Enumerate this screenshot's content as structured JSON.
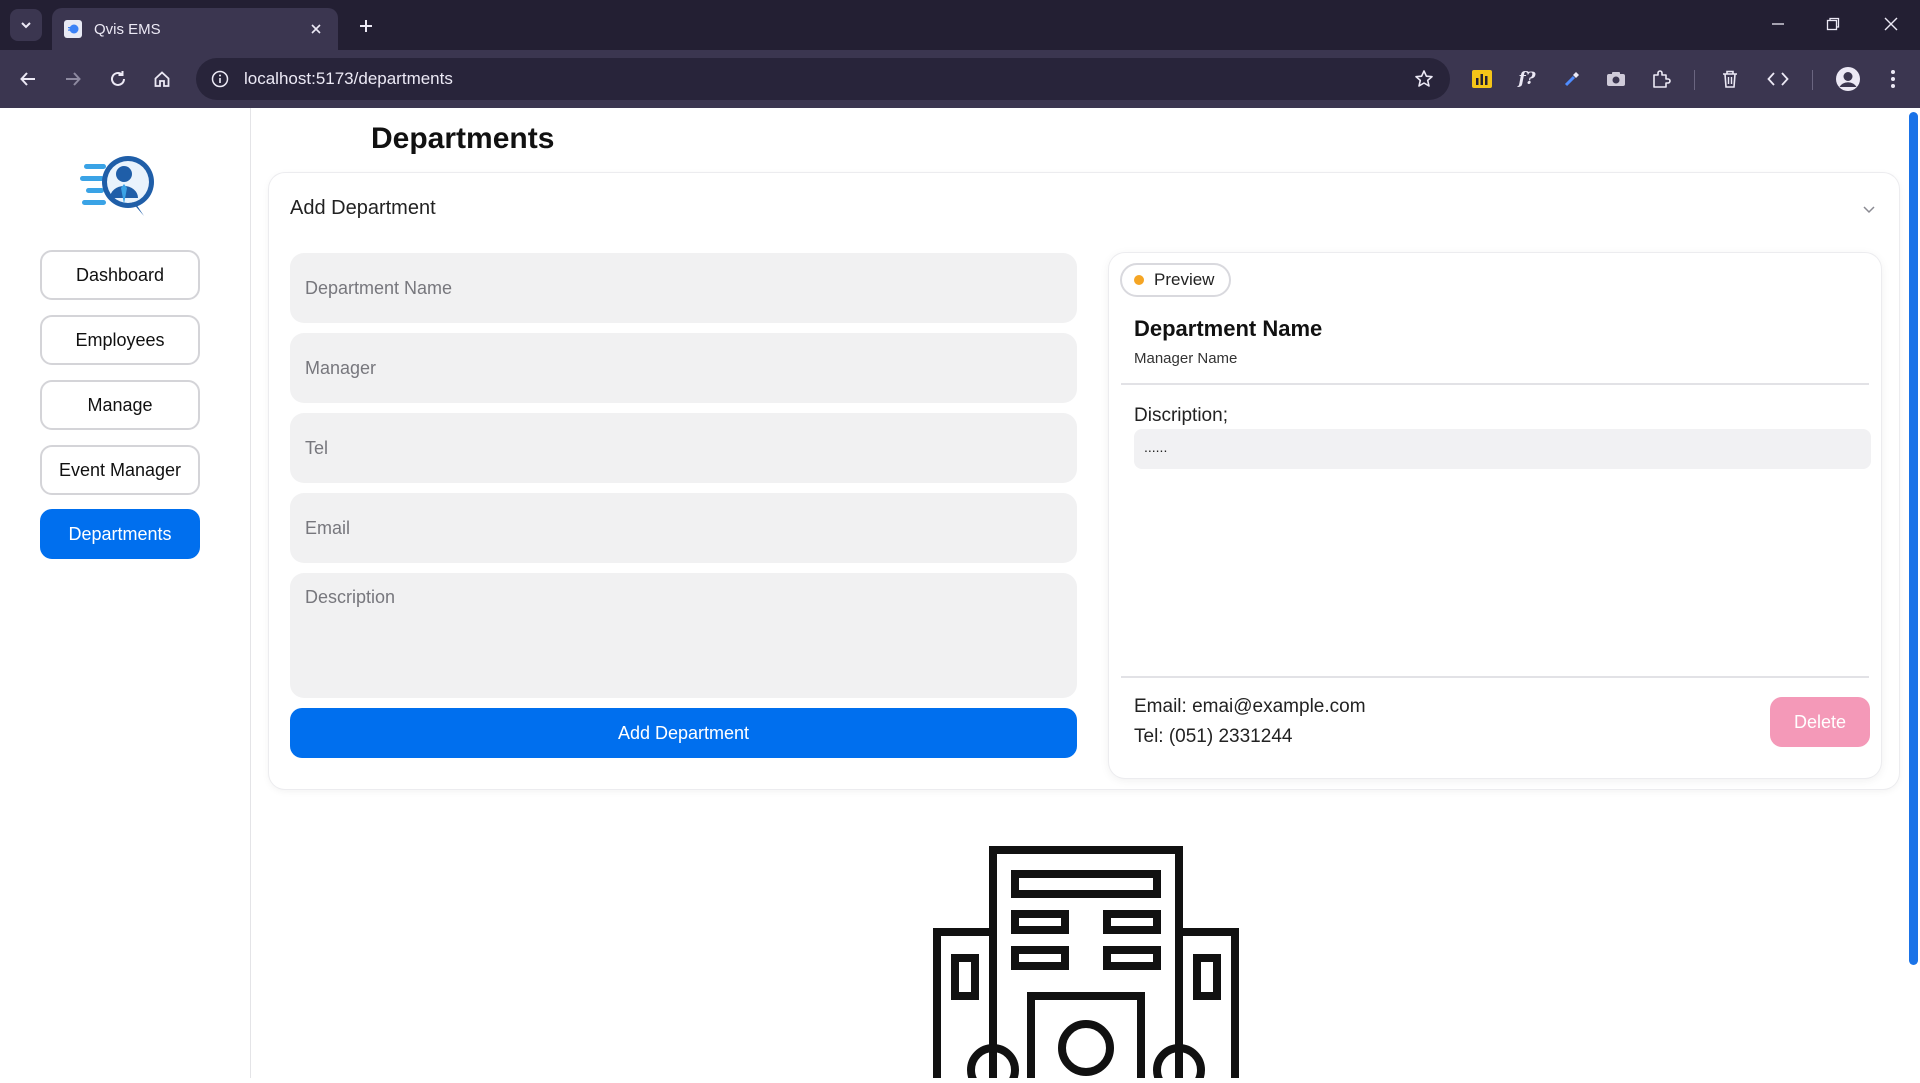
{
  "browser": {
    "tab_title": "Qvis EMS",
    "url": "localhost:5173/departments"
  },
  "sidebar": {
    "items": [
      {
        "label": "Dashboard",
        "active": false
      },
      {
        "label": "Employees",
        "active": false
      },
      {
        "label": "Manage",
        "active": false
      },
      {
        "label": "Event Manager",
        "active": false
      },
      {
        "label": "Departments",
        "active": true
      }
    ]
  },
  "page": {
    "title": "Departments"
  },
  "form": {
    "accordion_title": "Add Department",
    "placeholders": {
      "name": "Department Name",
      "manager": "Manager",
      "tel": "Tel",
      "email": "Email",
      "description": "Description"
    },
    "submit_label": "Add Department"
  },
  "preview": {
    "chip_label": "Preview",
    "department_name": "Department Name",
    "manager_name": "Manager Name",
    "description_label": "Discription;",
    "description_value": "......",
    "email_text": "Email: emai@example.com",
    "tel_text": "Tel: (051) 2331244",
    "delete_label": "Delete"
  },
  "colors": {
    "primary": "#006fee",
    "danger_light": "#f499b8",
    "preview_dot": "#f5a524",
    "chrome_dark": "#231f33",
    "chrome_toolbar": "#3b3650"
  }
}
